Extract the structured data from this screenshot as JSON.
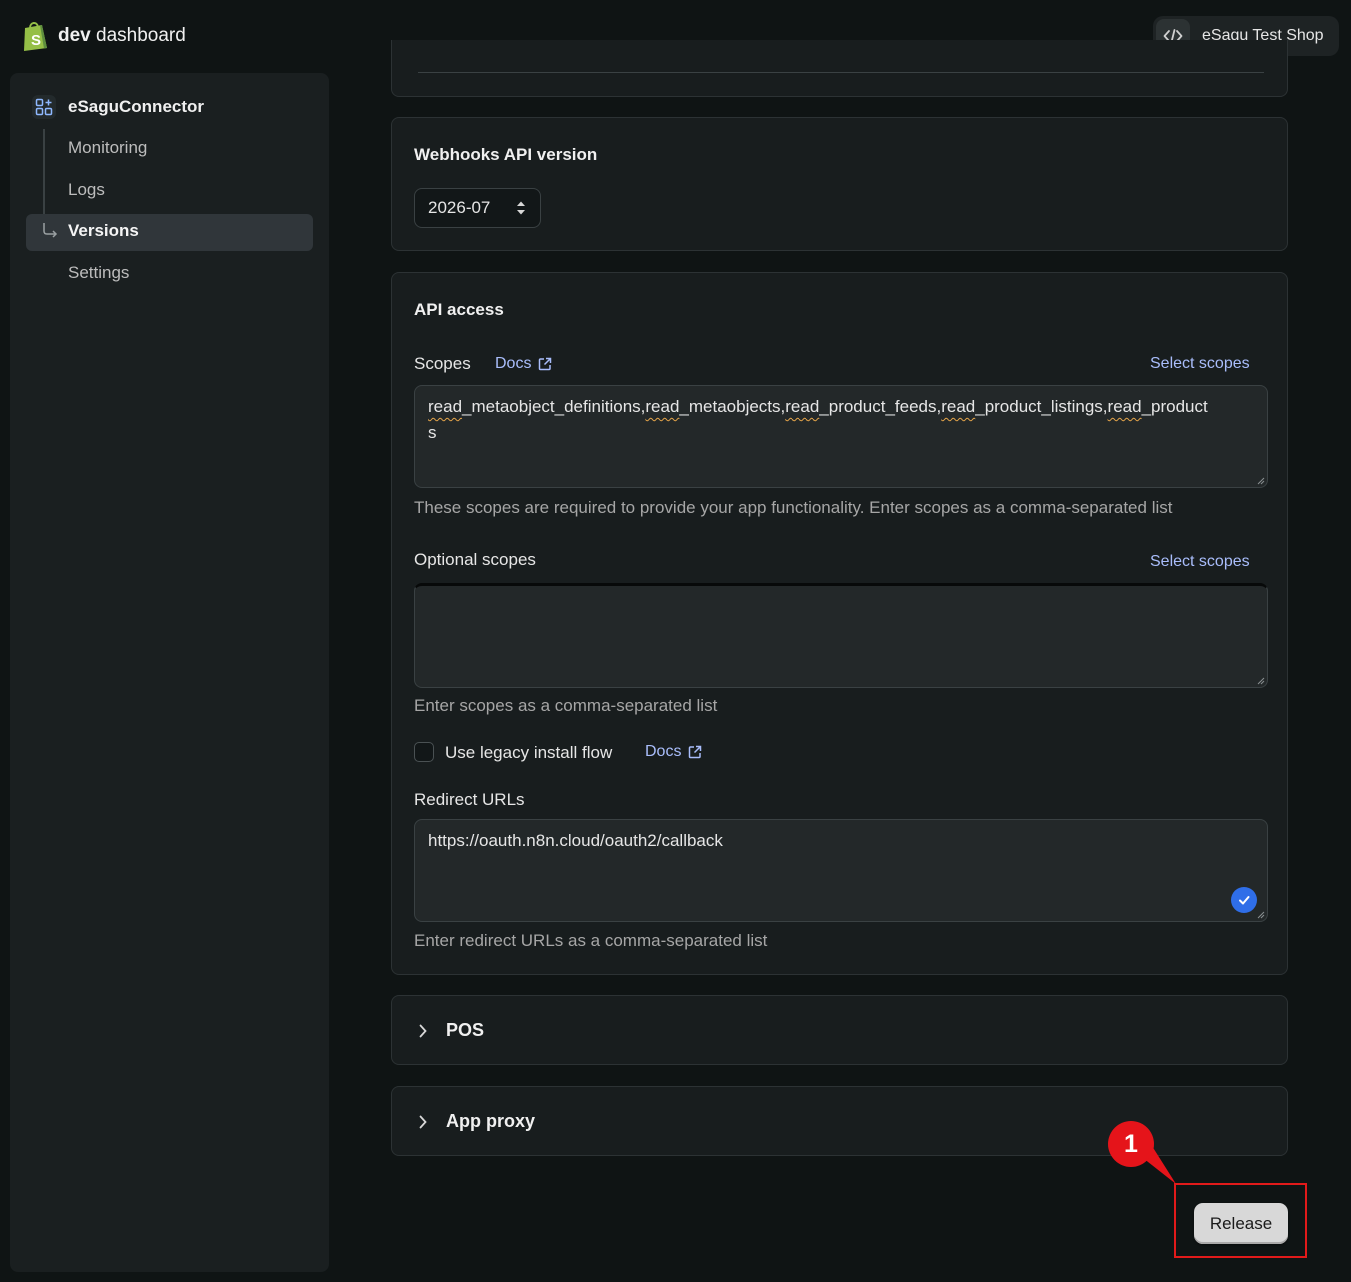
{
  "header": {
    "brand_bold": "dev",
    "brand_rest": " dashboard",
    "shop_name": "eSagu Test Shop",
    "shop_icon": "code-icon"
  },
  "sidebar": {
    "app_name": "eSaguConnector",
    "items": [
      {
        "label": "Monitoring",
        "active": false
      },
      {
        "label": "Logs",
        "active": false
      },
      {
        "label": "Versions",
        "active": true
      },
      {
        "label": "Settings",
        "active": false
      }
    ]
  },
  "webhooks": {
    "title": "Webhooks API version",
    "selected_version": "2026-07"
  },
  "api_access": {
    "title": "API access",
    "scopes_label": "Scopes",
    "docs_link": "Docs",
    "select_scopes": "Select scopes",
    "scopes_line1": [
      "read",
      "_metaobject_definitions,",
      "read",
      "_metaobjects,",
      "read",
      "_product_feeds,",
      "read",
      "_product_listings,",
      "read",
      "_product"
    ],
    "scopes_line2": "s",
    "scopes_help": "These scopes are required to provide your app functionality. Enter scopes as a comma-separated list",
    "optional_label": "Optional scopes",
    "optional_select": "Select scopes",
    "optional_value": "",
    "optional_help": "Enter scopes as a comma-separated list",
    "legacy_label": "Use legacy install flow",
    "legacy_docs": "Docs",
    "legacy_checked": false,
    "redirect_label": "Redirect URLs",
    "redirect_value": "https://oauth.n8n.cloud/oauth2/callback",
    "redirect_help": "Enter redirect URLs as a comma-separated list"
  },
  "sections": {
    "pos": "POS",
    "app_proxy": "App proxy"
  },
  "actions": {
    "release": "Release"
  },
  "annotation": {
    "number": "1"
  },
  "colors": {
    "background": "#0f1414",
    "card": "#181d1e",
    "link": "#a9bdfb",
    "brand_green": "#95bf47",
    "annotation_red": "#e5141a",
    "check_blue": "#2f6ee8"
  }
}
